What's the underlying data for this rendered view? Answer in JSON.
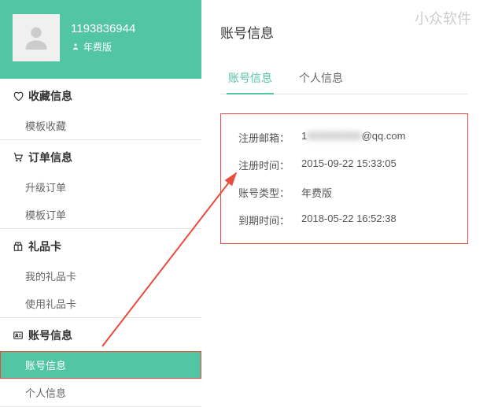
{
  "watermark": "小众软件",
  "profile": {
    "username": "1193836944",
    "badge_label": "年费版"
  },
  "sidebar": {
    "sections": [
      {
        "title": "收藏信息",
        "items": [
          "模板收藏"
        ]
      },
      {
        "title": "订单信息",
        "items": [
          "升级订单",
          "模板订单"
        ]
      },
      {
        "title": "礼品卡",
        "items": [
          "我的礼品卡",
          "使用礼品卡"
        ]
      },
      {
        "title": "账号信息",
        "items": [
          "账号信息",
          "个人信息"
        ]
      }
    ],
    "active": "账号信息"
  },
  "main": {
    "title": "账号信息",
    "tabs": [
      "账号信息",
      "个人信息"
    ],
    "active_tab": 0,
    "info": {
      "email_label": "注册邮箱：",
      "email_prefix": "1",
      "email_blur": "XXXXXXXX",
      "email_suffix": "@qq.com",
      "reg_time_label": "注册时间：",
      "reg_time_value": "2015-09-22 15:33:05",
      "type_label": "账号类型：",
      "type_value": "年费版",
      "expire_label": "到期时间：",
      "expire_value": "2018-05-22 16:52:38"
    }
  }
}
